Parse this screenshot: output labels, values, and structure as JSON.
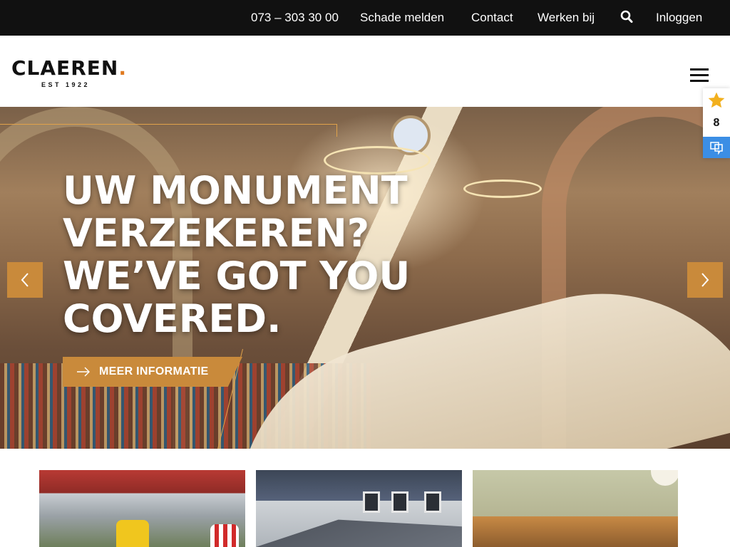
{
  "topbar": {
    "phone": "073 – 303 30 00",
    "report_damage": "Schade melden",
    "contact": "Contact",
    "careers": "Werken bij",
    "login": "Inloggen"
  },
  "logo": {
    "word": "CLAEREN",
    "dot": ".",
    "tagline": "EST 1922"
  },
  "rating": {
    "score": "8"
  },
  "hero": {
    "headline_lines": [
      "UW MONUMENT",
      "VERZEKEREN?",
      "WE’VE GOT YOU",
      "COVERED."
    ],
    "cta_label": "MEER INFORMATIE"
  },
  "colors": {
    "accent": "#c98a3b",
    "topbar": "#111111",
    "logo_dot": "#e07a1f",
    "chat": "#3b8ee5"
  }
}
